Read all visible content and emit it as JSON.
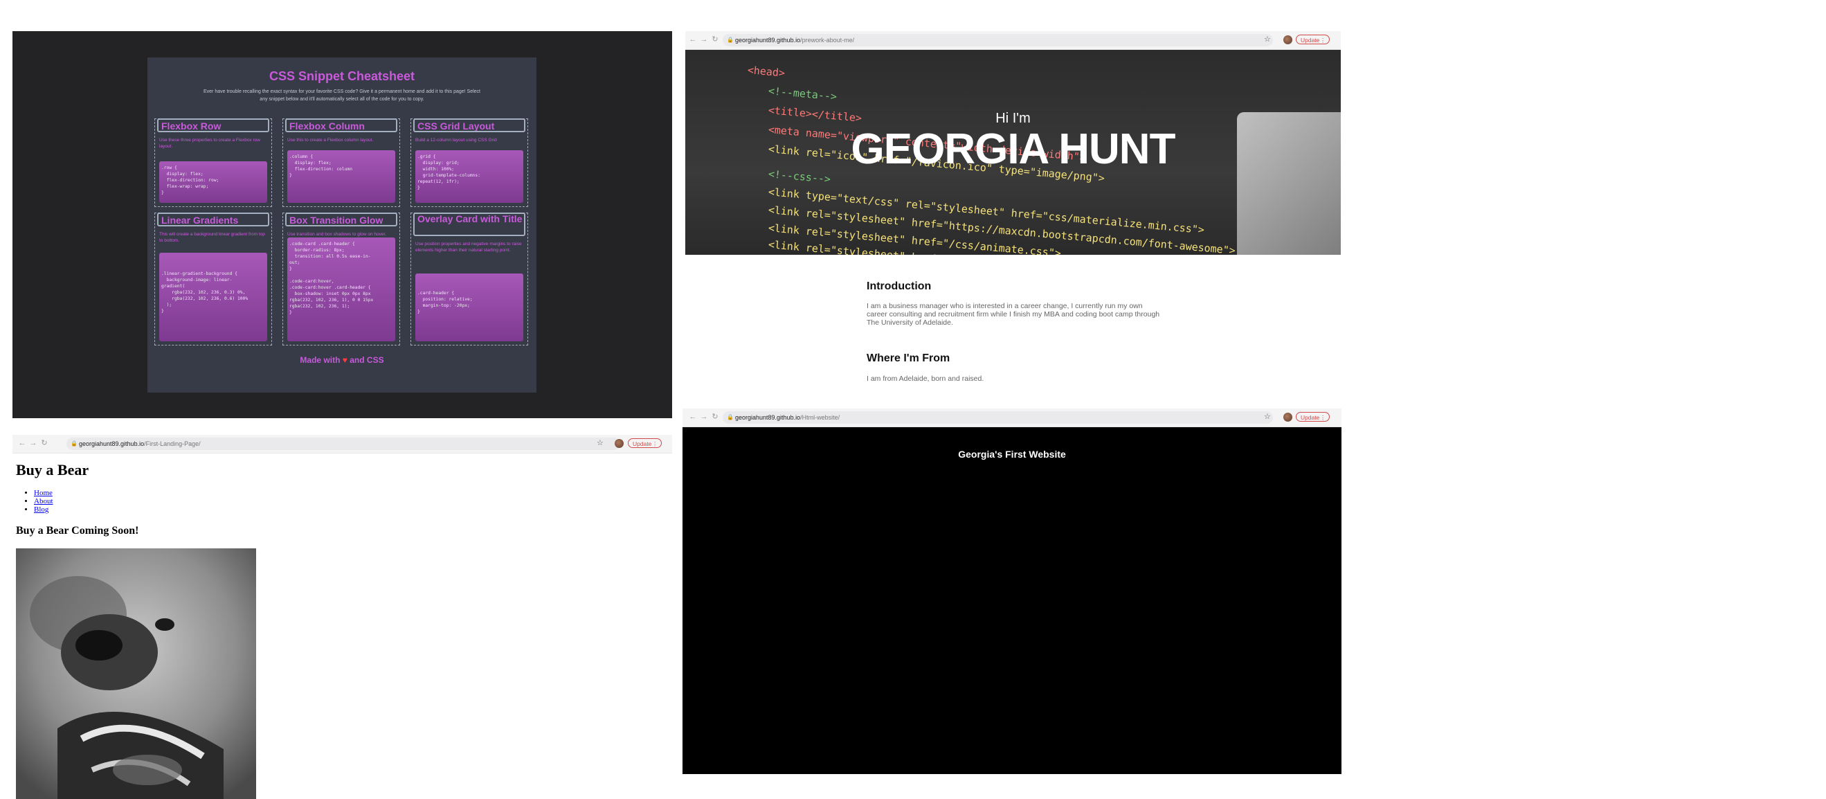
{
  "cheatsheet": {
    "title": "CSS Snippet Cheatsheet",
    "subtitle": "Ever have trouble recalling the exact syntax for your favorite CSS code? Give it a permanent home and add it to this page! Select any snippet below and it'll automatically select all of the code for you to copy.",
    "cards": [
      {
        "title": "Flexbox Row",
        "desc": "Use these three properties to create a Flexbox row layout.",
        "code": ".row {\n  display: flex;\n  flex-direction: row;\n  flex-wrap: wrap;\n}"
      },
      {
        "title": "Flexbox Column",
        "desc": "Use this to create a Flexbox column layout.",
        "code": ".column {\n  display: flex;\n  flex-direction: column\n}"
      },
      {
        "title": "CSS Grid Layout",
        "desc": "Build a 12-column layout using CSS Grid",
        "code": ".grid {\n  display: grid;\n  width: 100%;\n  grid-template-columns:\nrepeat(12, 1fr);\n}"
      },
      {
        "title": "Linear Gradients",
        "desc": "This will create a background linear gradient from top to bottom.",
        "code": ".linear-gradient-background {\n  background-image: linear-\ngradient(\n    rgba(232, 102, 236, 0.3) 0%,\n    rgba(232, 102, 236, 0.6) 100%\n  );\n}"
      },
      {
        "title": "Box Transition Glow",
        "desc": "Use transition and box shadows to glow on hover.",
        "code": ".code-card .card-header {\n  border-radius: 8px;\n  transition: all 0.5s ease-in-\nout;\n}\n\n.code-card:hover,\n.code-card:hover .card-header {\n  box-shadow: inset 0px 0px 8px\nrgba(232, 102, 236, 1), 0 0 15px\nrgba(232, 102, 236, 1);\n}"
      },
      {
        "title": "Overlay Card with Title",
        "desc": "Use position properties and negative margins to raise elements higher than their natural starting point.",
        "code": ".card-header {\n  position: relative;\n  margin-top: -20px;\n}"
      }
    ],
    "footer_prefix": "Made with",
    "footer_heart": "♥",
    "footer_suffix": "and CSS"
  },
  "about_me": {
    "url_host": "georgiahunt89.github.io",
    "url_path": "/prework-about-me/",
    "update_label": "Update",
    "hero_greeting": "Hi I'm",
    "hero_name": "GEORGIA HUNT",
    "sections": [
      {
        "heading": "Introduction",
        "text": "I am a business manager who is interested in a career change, I currently run my own career consulting and recruitment firm while I finish my MBA and coding boot camp through The University of Adelaide."
      },
      {
        "heading": "Where I'm From",
        "text": "I am from Adelaide, born and raised."
      }
    ]
  },
  "landing": {
    "url_host": "georgiahunt89.github.io",
    "url_path": "/First-Landing-Page/",
    "update_label": "Update",
    "heading": "Buy a Bear",
    "nav": [
      "Home",
      "About",
      "Blog"
    ],
    "subheading": "Buy a Bear Coming Soon!"
  },
  "first_site": {
    "url_host": "georgiahunt89.github.io",
    "url_path": "/Html-website/",
    "update_label": "Update",
    "title": "Georgia's First Website"
  },
  "colors": {
    "accent_purple": "#c95adb",
    "update_red": "#d14a4a",
    "link_blue": "#0000ee"
  },
  "icons": [
    "back-icon",
    "forward-icon",
    "reload-icon",
    "lock-icon",
    "star-icon",
    "profile-avatar",
    "more-icon",
    "heart-icon"
  ]
}
